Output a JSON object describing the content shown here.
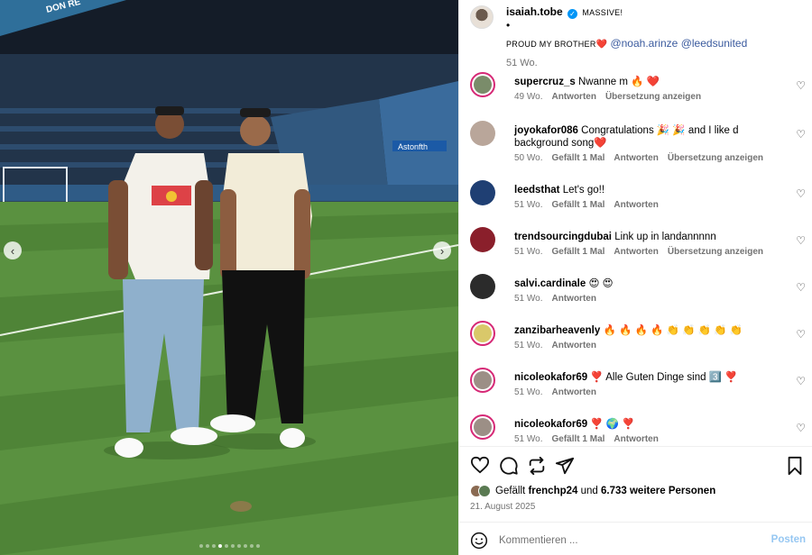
{
  "photo": {
    "prev_icon": "chevron-left-icon",
    "next_icon": "chevron-right-icon",
    "carousel": {
      "count": 10,
      "active_index": 3
    },
    "banner_text": "DON RE",
    "stand_sign": "Astonfth"
  },
  "caption": {
    "username": "isaiah.tobe",
    "verified_icon": "verified-badge-icon",
    "line1": "MASSIVE!",
    "line2": "•",
    "line3_prefix": "PROUD MY BROTHER",
    "line3_emoji": "❤️",
    "mention1": "@noah.arinze",
    "mention2": "@leedsunited",
    "time": "51 Wo."
  },
  "comments": [
    {
      "user": "supercruz_s",
      "text": "Nwanne m 🔥 ❤️",
      "time": "49 Wo.",
      "likes": "",
      "reply": "Antworten",
      "translate": "Übersetzung anzeigen",
      "ring": true,
      "color": "#7a8c6a"
    },
    {
      "user": "joyokafor086",
      "text": "Congratulations 🎉 🎉 and I like d background song❤️",
      "time": "50 Wo.",
      "likes": "Gefällt 1 Mal",
      "reply": "Antworten",
      "translate": "Übersetzung anzeigen",
      "ring": false,
      "color": "#b9a69a"
    },
    {
      "user": "leedsthat",
      "text": "Let's go!!",
      "time": "51 Wo.",
      "likes": "Gefällt 1 Mal",
      "reply": "Antworten",
      "translate": "",
      "ring": false,
      "color": "#1f3f73"
    },
    {
      "user": "trendsourcingdubai",
      "text": "Link up in landannnnn",
      "time": "51 Wo.",
      "likes": "Gefällt 1 Mal",
      "reply": "Antworten",
      "translate": "Übersetzung anzeigen",
      "ring": false,
      "color": "#8a1f2b"
    },
    {
      "user": "salvi.cardinale",
      "text": "😍 😍",
      "time": "51 Wo.",
      "likes": "",
      "reply": "Antworten",
      "translate": "",
      "ring": false,
      "color": "#2b2b2b"
    },
    {
      "user": "zanzibarheavenly",
      "text": "🔥 🔥 🔥 🔥 👏 👏 👏 👏 👏",
      "time": "51 Wo.",
      "likes": "",
      "reply": "Antworten",
      "translate": "",
      "ring": true,
      "color": "#d9c86a"
    },
    {
      "user": "nicoleokafor69",
      "text": "❣️  Alle Guten Dinge sind 3️⃣  ❣️",
      "time": "51 Wo.",
      "likes": "",
      "reply": "Antworten",
      "translate": "",
      "ring": true,
      "color": "#9c8f86"
    },
    {
      "user": "nicoleokafor69",
      "text": "❣️ 🌍 ❣️",
      "time": "51 Wo.",
      "likes": "Gefällt 1 Mal",
      "reply": "Antworten",
      "translate": "",
      "ring": true,
      "color": "#9c8f86"
    }
  ],
  "actions": {
    "like_icon": "heart-icon",
    "comment_icon": "comment-icon",
    "repost_icon": "repost-icon",
    "share_icon": "share-icon",
    "save_icon": "bookmark-icon"
  },
  "likes": {
    "prefix": "Gefällt",
    "user": "frenchp24",
    "mid": "und",
    "count": "6.733 weitere Personen"
  },
  "date": "21. August 2025",
  "composer": {
    "emoji_icon": "emoji-icon",
    "placeholder": "Kommentieren ...",
    "post_label": "Posten"
  }
}
